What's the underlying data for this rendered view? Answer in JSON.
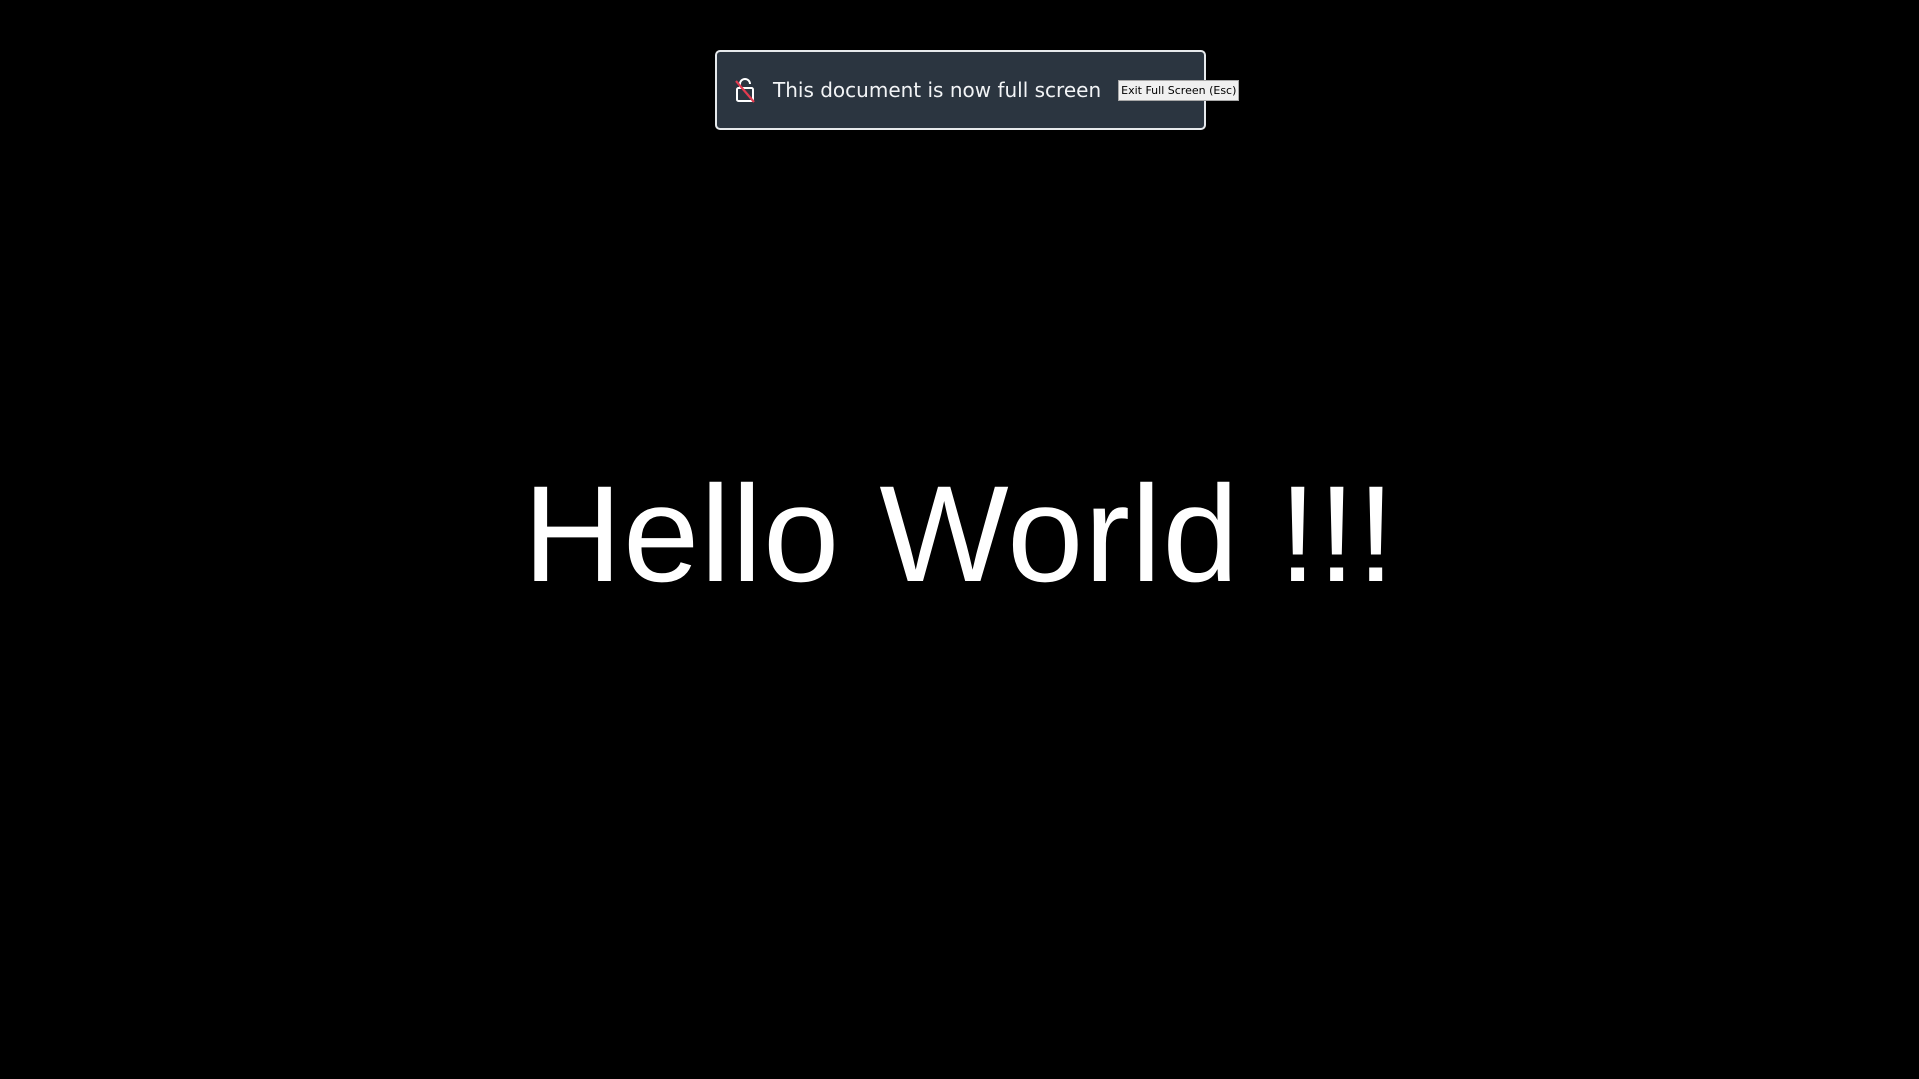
{
  "fullscreen_notice": {
    "icon": "fullscreen-lock-icon",
    "message": "This document is now full screen",
    "exit_button_label": "Exit Full Screen (Esc)",
    "colors": {
      "background": "#2b3540",
      "border": "#e6e9ec",
      "icon_accent": "#e23a4f"
    }
  },
  "document": {
    "heading": "Hello World !!!",
    "colors": {
      "background": "#000000",
      "text": "#ffffff"
    }
  }
}
